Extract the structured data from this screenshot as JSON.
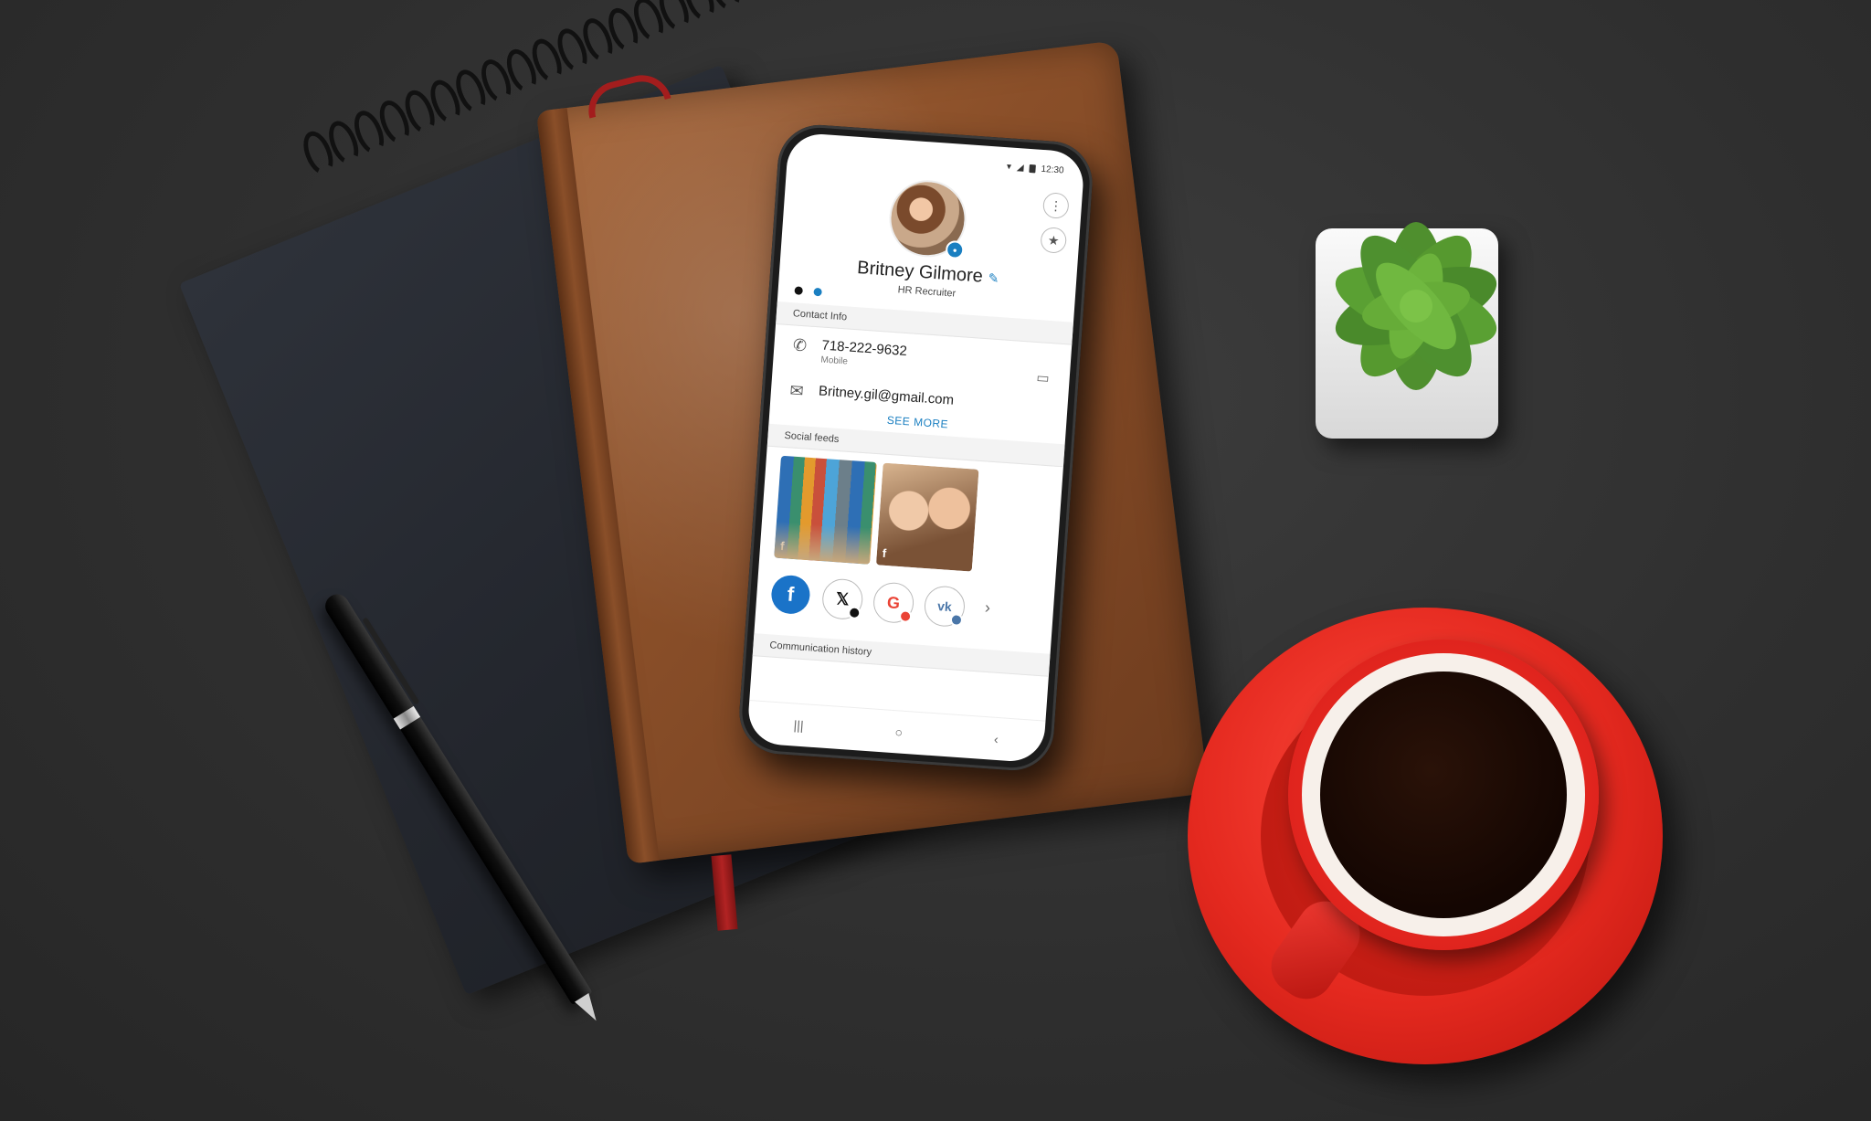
{
  "phone": {
    "status": {
      "time": "12:30"
    },
    "profile": {
      "name": "Britney Gilmore",
      "role": "HR Recruiter"
    },
    "contact_info": {
      "header": "Contact Info",
      "phone": {
        "number": "718-222-9632",
        "type": "Mobile"
      },
      "email": "Britney.gil@gmail.com",
      "see_more": "SEE MORE"
    },
    "social_feeds": {
      "header": "Social feeds",
      "networks": [
        {
          "name": "facebook",
          "glyph": "f",
          "color": "#1877f2"
        },
        {
          "name": "x",
          "glyph": "𝕏",
          "color": "#000000"
        },
        {
          "name": "google",
          "glyph": "G",
          "color": "#ea4335"
        },
        {
          "name": "vk",
          "glyph": "vk",
          "color": "#4a76a8"
        }
      ]
    },
    "communication_history": {
      "header": "Communication history"
    },
    "accent_color": "#1a7fc1"
  }
}
